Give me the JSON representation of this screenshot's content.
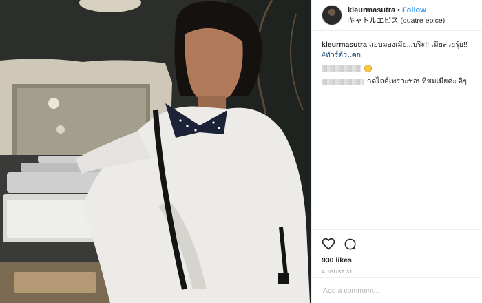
{
  "post": {
    "username": "kleurmasutra",
    "separator": "•",
    "follow_label": "Follow",
    "location": "キャトルエピス (quatre epice)",
    "caption": {
      "username": "kleurmasutra",
      "text": "แอบมองเมีย...บริะ!! เมียสวยรุ้ย!!",
      "hashtag": "#ทัวร์ตัวแตก"
    },
    "comments": [
      {
        "text": "",
        "emoji": "smiling-face-emoji"
      },
      {
        "text": "กดไลค์เพราะชอบที่ชมเมียค่ะ อิๆ"
      }
    ],
    "likes": "930 likes",
    "date": "AUGUST 31",
    "add_comment_placeholder": "Add a comment..."
  },
  "icons": {
    "like": "heart-outline-icon",
    "comment": "speech-bubble-icon"
  },
  "colors": {
    "link": "#3897f0",
    "hashtag": "#003569",
    "text": "#262626",
    "muted": "#999999",
    "border": "#efefef"
  }
}
